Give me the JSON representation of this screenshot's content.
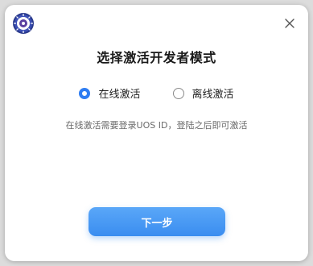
{
  "dialog": {
    "title": "选择激活开发者模式",
    "options": [
      {
        "label": "在线激活",
        "selected": true
      },
      {
        "label": "离线激活",
        "selected": false
      }
    ],
    "hint": "在线激活需要登录UOS ID，登陆之后即可激活",
    "next_label": "下一步"
  },
  "icons": {
    "logo": "uos-developer-logo",
    "close": "close-icon"
  },
  "colors": {
    "accent": "#2f7df2",
    "button_gradient_top": "#5aa7f8",
    "button_gradient_bottom": "#3a8df0"
  }
}
